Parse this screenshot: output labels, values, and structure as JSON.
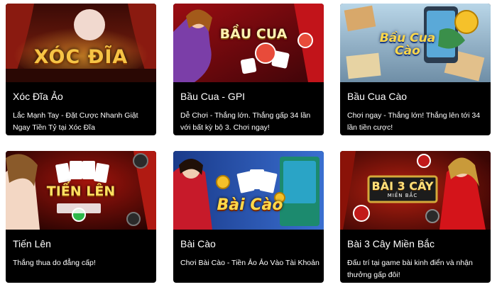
{
  "games": [
    {
      "title": "Xóc Đĩa Ảo",
      "description": "Lắc Mạnh Tay - Đặt Cược Nhanh Giật Ngay Tiền Tỷ tại Xóc Đĩa",
      "logo_text": "XÓC ĐĨA",
      "image": "xoc-dia-banner"
    },
    {
      "title": "Bầu Cua - GPI",
      "description": "Dễ Chơi - Thắng lớn. Thắng gấp 34 lần với bất kỳ bộ 3. Chơi ngay!",
      "logo_text": "BẦU CUA",
      "image": "bau-cua-gpi-banner"
    },
    {
      "title": "Bầu Cua Cào",
      "description": "Chơi ngay - Thắng lớn! Thắng lên tới 34 lần tiền cược!",
      "logo_text": "Bầu Cua Cào",
      "image": "bau-cua-cao-banner"
    },
    {
      "title": "Tiến Lên",
      "description": "Thắng thua do đẳng cấp!",
      "logo_text": "TIẾN LÊN",
      "image": "tien-len-banner"
    },
    {
      "title": "Bài Cào",
      "description": "Chơi Bài Cào - Tiền Ảo Ảo Vào Tài Khoản",
      "logo_text": "Bài Cào",
      "image": "bai-cao-banner"
    },
    {
      "title": "Bài 3 Cây Miền Bắc",
      "description": "Đấu trí tại game bài kinh điển và nhận thưởng gấp đôi!",
      "logo_text": "BÀI 3 CÂY",
      "logo_subtext": "MIỀN BẮC",
      "image": "bai-3-cay-banner"
    }
  ]
}
